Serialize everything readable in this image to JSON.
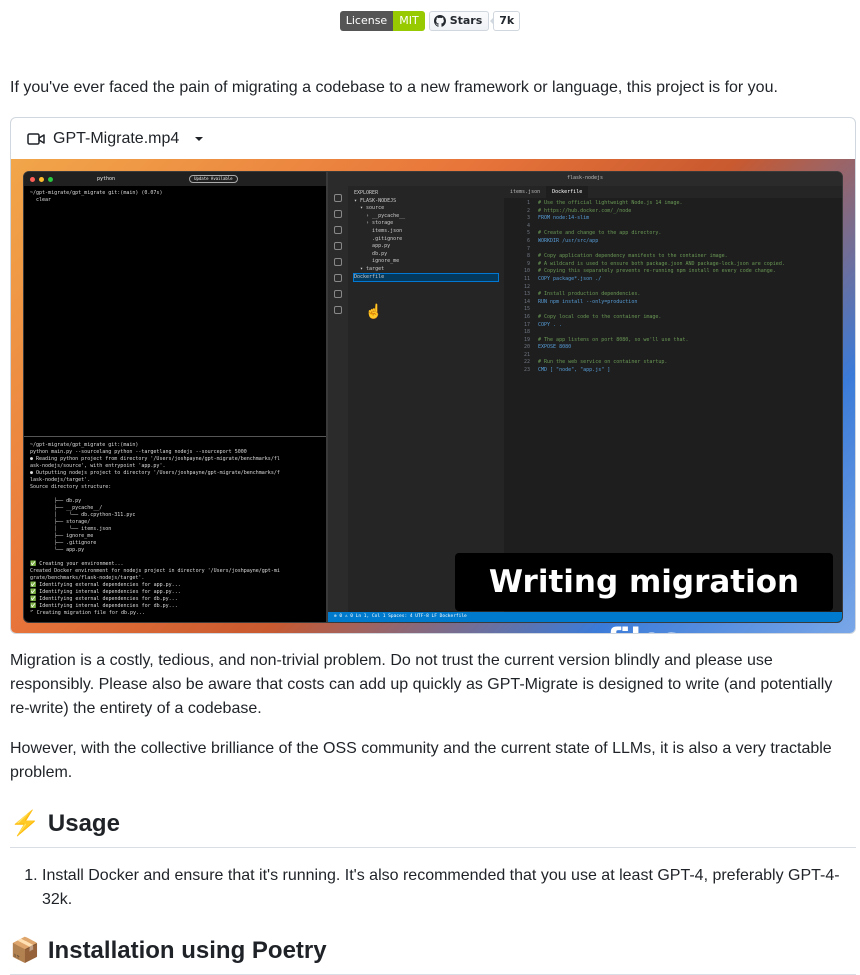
{
  "badges": {
    "license_label": "License",
    "license_value": "MIT",
    "stars_label": "Stars",
    "stars_count": "7k"
  },
  "intro": "If you've ever faced the pain of migrating a codebase to a new framework or language, this project is for you.",
  "video": {
    "filename": "GPT-Migrate.mp4",
    "overlay_text": "Writing migration files",
    "terminal": {
      "tab_title": "python",
      "update_label": "Update Available",
      "top_lines": "~/gpt-migrate/gpt_migrate git:(main) (0.07s)\n  clear",
      "lower_lines": "~/gpt-migrate/gpt_migrate git:(main)\npython main.py --sourcelang python --targetlang nodejs --sourceport 5000\n● Reading python project from directory '/Users/joshpayne/gpt-migrate/benchmarks/fl\nask-nodejs/source', with entrypoint 'app.py'.\n● Outputting nodejs project to directory '/Users/joshpayne/gpt-migrate/benchmarks/f\nlask-nodejs/target'.\nSource directory structure:\n\n        ├── db.py\n        ├── __pycache__/\n        │    └── db.cpython-311.pyc\n        ├── storage/\n        │    └── items.json\n        ├── ignore_me\n        ├── .gitignore\n        └── app.py\n\n✅ Creating your environment...\nCreated Docker environment for nodejs project in directory '/Users/joshpayne/gpt-mi\ngrate/benchmarks/flask-nodejs/target'.\n✅ Identifying external dependencies for app.py...\n✅ Identifying internal dependencies for app.py...\n✅ Identifying external dependencies for db.py...\n✅ Identifying internal dependencies for db.py...\n⠋ Creating migration file for db.py..."
    },
    "editor": {
      "window_title": "flask-nodejs",
      "explorer_lines": "EXPLORER\n▾ FLASK-NODEJS\n  ▾ source\n    › __pycache__\n    › storage\n      items.json\n      .gitignore\n      app.py\n      db.py\n      ignore_me\n  ▾ target",
      "selected_file": "Dockerfile",
      "tab_inactive": "items.json",
      "tab_active": "Dockerfile",
      "code_lines": [
        {
          "n": "1",
          "t": "# Use the official lightweight Node.js 14 image.",
          "c": "cm"
        },
        {
          "n": "2",
          "t": "# https://hub.docker.com/_/node",
          "c": "cm"
        },
        {
          "n": "3",
          "t": "FROM node:14-slim",
          "c": "kw"
        },
        {
          "n": "4",
          "t": "",
          "c": ""
        },
        {
          "n": "5",
          "t": "# Create and change to the app directory.",
          "c": "cm"
        },
        {
          "n": "6",
          "t": "WORKDIR /usr/src/app",
          "c": "kw"
        },
        {
          "n": "7",
          "t": "",
          "c": ""
        },
        {
          "n": "8",
          "t": "# Copy application dependency manifests to the container image.",
          "c": "cm"
        },
        {
          "n": "9",
          "t": "# A wildcard is used to ensure both package.json AND package-lock.json are copied.",
          "c": "cm"
        },
        {
          "n": "10",
          "t": "# Copying this separately prevents re-running npm install on every code change.",
          "c": "cm"
        },
        {
          "n": "11",
          "t": "COPY package*.json ./",
          "c": "kw"
        },
        {
          "n": "12",
          "t": "",
          "c": ""
        },
        {
          "n": "13",
          "t": "# Install production dependencies.",
          "c": "cm"
        },
        {
          "n": "14",
          "t": "RUN npm install --only=production",
          "c": "kw"
        },
        {
          "n": "15",
          "t": "",
          "c": ""
        },
        {
          "n": "16",
          "t": "# Copy local code to the container image.",
          "c": "cm"
        },
        {
          "n": "17",
          "t": "COPY . .",
          "c": "kw"
        },
        {
          "n": "18",
          "t": "",
          "c": ""
        },
        {
          "n": "19",
          "t": "# The app listens on port 8080, so we'll use that.",
          "c": "cm"
        },
        {
          "n": "20",
          "t": "EXPOSE 8080",
          "c": "kw"
        },
        {
          "n": "21",
          "t": "",
          "c": ""
        },
        {
          "n": "22",
          "t": "# Run the web service on container startup.",
          "c": "cm"
        },
        {
          "n": "23",
          "t": "CMD [ \"node\", \"app.js\" ]",
          "c": "kw"
        }
      ],
      "status_text": "⊗ 0 ⚠ 0          Ln 1, Col 1   Spaces: 4   UTF-8   LF   Dockerfile"
    }
  },
  "warning": "Migration is a costly, tedious, and non-trivial problem. Do not trust the current version blindly and please use responsibly. Please also be aware that costs can add up quickly as GPT-Migrate is designed to write (and potentially re-write) the entirety of a codebase.",
  "tractable": "However, with the collective brilliance of the OSS community and the current state of LLMs, it is also a very tractable problem.",
  "usage": {
    "emoji": "⚡",
    "title": "Usage",
    "steps": [
      "Install Docker and ensure that it's running. It's also recommended that you use at least GPT-4, preferably GPT-4-32k."
    ]
  },
  "install": {
    "emoji": "📦",
    "title": "Installation using Poetry"
  }
}
